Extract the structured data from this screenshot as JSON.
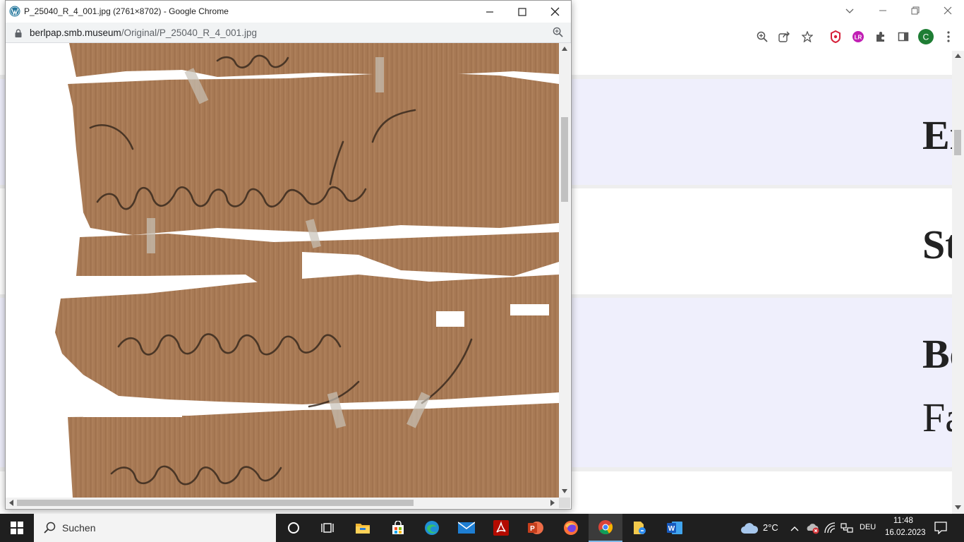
{
  "popup": {
    "title": "P_25040_R_4_001.jpg (2761×8702) - Google Chrome",
    "url_host": "berlpap.smb.museum",
    "url_path": "/Original/P_25040_R_4_001.jpg"
  },
  "background_page": {
    "bands": [
      {
        "text": "Er"
      },
      {
        "text": "St"
      },
      {
        "text": "Be",
        "second_line": "Fa"
      }
    ]
  },
  "toolbar": {
    "profile_initial": "C",
    "ext_badge": "LR"
  },
  "taskbar": {
    "search_label": "Suchen",
    "weather": "2°C",
    "language": "DEU",
    "time": "11:48",
    "date": "16.02.2023"
  },
  "colors": {
    "band_tint": "#efeffc",
    "papyrus": "#a87a55",
    "taskbar": "#1f1f1f",
    "accent_green": "#1e7d34"
  }
}
